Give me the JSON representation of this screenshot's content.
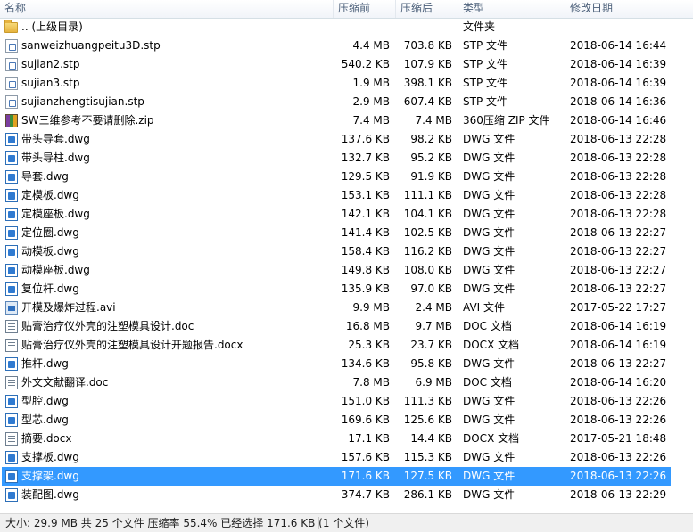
{
  "columns": {
    "name": "名称",
    "original_size": "压缩前",
    "compressed_size": "压缩后",
    "type": "类型",
    "modified": "修改日期"
  },
  "files": [
    {
      "name": ".. (上级目录)",
      "original": "",
      "compressed": "",
      "type": "文件夹",
      "modified": "",
      "icon": "folder-icon"
    },
    {
      "name": "sanweizhuangpeitu3D.stp",
      "original": "4.4 MB",
      "compressed": "703.8 KB",
      "type": "STP 文件",
      "modified": "2018-06-14 16:44",
      "icon": "stp-file-icon"
    },
    {
      "name": "sujian2.stp",
      "original": "540.2 KB",
      "compressed": "107.9 KB",
      "type": "STP 文件",
      "modified": "2018-06-14 16:39",
      "icon": "stp-file-icon"
    },
    {
      "name": "sujian3.stp",
      "original": "1.9 MB",
      "compressed": "398.1 KB",
      "type": "STP 文件",
      "modified": "2018-06-14 16:39",
      "icon": "stp-file-icon"
    },
    {
      "name": "sujianzhengtisujian.stp",
      "original": "2.9 MB",
      "compressed": "607.4 KB",
      "type": "STP 文件",
      "modified": "2018-06-14 16:36",
      "icon": "stp-file-icon"
    },
    {
      "name": "SW三维参考不要请删除.zip",
      "original": "7.4 MB",
      "compressed": "7.4 MB",
      "type": "360压缩 ZIP 文件",
      "modified": "2018-06-14 16:46",
      "icon": "zip-archive-icon"
    },
    {
      "name": "带头导套.dwg",
      "original": "137.6 KB",
      "compressed": "98.2 KB",
      "type": "DWG 文件",
      "modified": "2018-06-13 22:28",
      "icon": "dwg-file-icon"
    },
    {
      "name": "带头导柱.dwg",
      "original": "132.7 KB",
      "compressed": "95.2 KB",
      "type": "DWG 文件",
      "modified": "2018-06-13 22:28",
      "icon": "dwg-file-icon"
    },
    {
      "name": "导套.dwg",
      "original": "129.5 KB",
      "compressed": "91.9 KB",
      "type": "DWG 文件",
      "modified": "2018-06-13 22:28",
      "icon": "dwg-file-icon"
    },
    {
      "name": "定模板.dwg",
      "original": "153.1 KB",
      "compressed": "111.1 KB",
      "type": "DWG 文件",
      "modified": "2018-06-13 22:28",
      "icon": "dwg-file-icon"
    },
    {
      "name": "定模座板.dwg",
      "original": "142.1 KB",
      "compressed": "104.1 KB",
      "type": "DWG 文件",
      "modified": "2018-06-13 22:28",
      "icon": "dwg-file-icon"
    },
    {
      "name": "定位圈.dwg",
      "original": "141.4 KB",
      "compressed": "102.5 KB",
      "type": "DWG 文件",
      "modified": "2018-06-13 22:27",
      "icon": "dwg-file-icon"
    },
    {
      "name": "动模板.dwg",
      "original": "158.4 KB",
      "compressed": "116.2 KB",
      "type": "DWG 文件",
      "modified": "2018-06-13 22:27",
      "icon": "dwg-file-icon"
    },
    {
      "name": "动模座板.dwg",
      "original": "149.8 KB",
      "compressed": "108.0 KB",
      "type": "DWG 文件",
      "modified": "2018-06-13 22:27",
      "icon": "dwg-file-icon"
    },
    {
      "name": "复位杆.dwg",
      "original": "135.9 KB",
      "compressed": "97.0 KB",
      "type": "DWG 文件",
      "modified": "2018-06-13 22:27",
      "icon": "dwg-file-icon"
    },
    {
      "name": "开模及爆炸过程.avi",
      "original": "9.9 MB",
      "compressed": "2.4 MB",
      "type": "AVI 文件",
      "modified": "2017-05-22 17:27",
      "icon": "avi-video-icon"
    },
    {
      "name": "贴膏治疗仪外壳的注塑模具设计.doc",
      "original": "16.8 MB",
      "compressed": "9.7 MB",
      "type": "DOC 文档",
      "modified": "2018-06-14 16:19",
      "icon": "doc-file-icon"
    },
    {
      "name": "贴膏治疗仪外壳的注塑模具设计开题报告.docx",
      "original": "25.3 KB",
      "compressed": "23.7 KB",
      "type": "DOCX 文档",
      "modified": "2018-06-14 16:19",
      "icon": "doc-file-icon"
    },
    {
      "name": "推杆.dwg",
      "original": "134.6 KB",
      "compressed": "95.8 KB",
      "type": "DWG 文件",
      "modified": "2018-06-13 22:27",
      "icon": "dwg-file-icon"
    },
    {
      "name": "外文文献翻译.doc",
      "original": "7.8 MB",
      "compressed": "6.9 MB",
      "type": "DOC 文档",
      "modified": "2018-06-14 16:20",
      "icon": "doc-file-icon"
    },
    {
      "name": "型腔.dwg",
      "original": "151.0 KB",
      "compressed": "111.3 KB",
      "type": "DWG 文件",
      "modified": "2018-06-13 22:26",
      "icon": "dwg-file-icon"
    },
    {
      "name": "型芯.dwg",
      "original": "169.6 KB",
      "compressed": "125.6 KB",
      "type": "DWG 文件",
      "modified": "2018-06-13 22:26",
      "icon": "dwg-file-icon"
    },
    {
      "name": "摘要.docx",
      "original": "17.1 KB",
      "compressed": "14.4 KB",
      "type": "DOCX 文档",
      "modified": "2017-05-21 18:48",
      "icon": "doc-file-icon"
    },
    {
      "name": "支撑板.dwg",
      "original": "157.6 KB",
      "compressed": "115.3 KB",
      "type": "DWG 文件",
      "modified": "2018-06-13 22:26",
      "icon": "dwg-file-icon"
    },
    {
      "name": "支撑架.dwg",
      "original": "171.6 KB",
      "compressed": "127.5 KB",
      "type": "DWG 文件",
      "modified": "2018-06-13 22:26",
      "icon": "dwg-file-icon",
      "selected": true
    },
    {
      "name": "装配图.dwg",
      "original": "374.7 KB",
      "compressed": "286.1 KB",
      "type": "DWG 文件",
      "modified": "2018-06-13 22:29",
      "icon": "dwg-file-icon"
    }
  ],
  "status": {
    "text": "大小: 29.9 MB 共 25 个文件 压缩率 55.4% 已经选择 171.6 KB (1 个文件)"
  },
  "colors": {
    "selection": "#3399ff",
    "header_text": "#4c607a"
  }
}
